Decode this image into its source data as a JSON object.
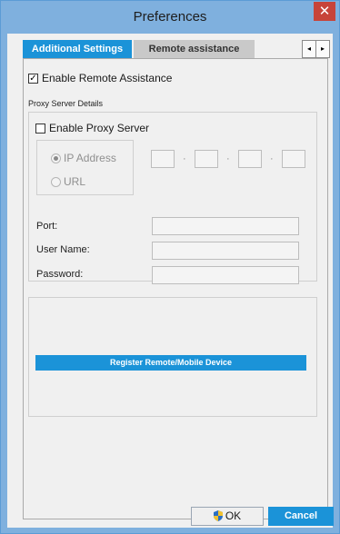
{
  "window": {
    "title": "Preferences",
    "close_icon": "close-icon",
    "colors": {
      "accent": "#1b93d8",
      "title_bar": "#7fb0de",
      "close": "#c7443a"
    }
  },
  "tabs": [
    {
      "label": "Additional Settings",
      "active": true
    },
    {
      "label": "Remote assistance",
      "active": false
    }
  ],
  "tab_nav": {
    "left": "◂",
    "right": "▸"
  },
  "remote": {
    "enable_label": "Enable Remote Assistance",
    "checked": true
  },
  "proxy": {
    "group_title": "Proxy Server Details",
    "enable_label": "Enable Proxy Server",
    "enabled": false,
    "radio_ip": {
      "label": "IP Address",
      "selected": true
    },
    "radio_url": {
      "label": "URL",
      "selected": false
    },
    "ip_separator": "·",
    "ip_octets": [
      "",
      "",
      "",
      ""
    ],
    "fields": [
      {
        "label": "Port:",
        "value": ""
      },
      {
        "label": "User Name:",
        "value": ""
      },
      {
        "label": "Password:",
        "value": ""
      }
    ]
  },
  "register_label": "Register Remote/Mobile Device",
  "footer": {
    "ok_label": "OK",
    "cancel_label": "Cancel"
  }
}
